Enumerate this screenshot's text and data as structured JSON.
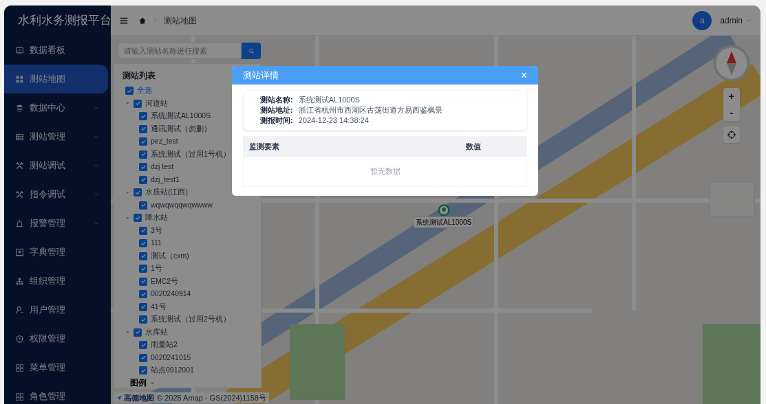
{
  "brand": {
    "title": "水利水务测报平台"
  },
  "sidebar": {
    "items": [
      {
        "label": "数据看板",
        "selected": false,
        "expandable": false
      },
      {
        "label": "测站地图",
        "selected": true,
        "expandable": false
      },
      {
        "label": "数据中心",
        "selected": false,
        "expandable": true
      },
      {
        "label": "测站管理",
        "selected": false,
        "expandable": true
      },
      {
        "label": "测站调试",
        "selected": false,
        "expandable": true
      },
      {
        "label": "指令调试",
        "selected": false,
        "expandable": true
      },
      {
        "label": "报警管理",
        "selected": false,
        "expandable": true
      },
      {
        "label": "字典管理",
        "selected": false,
        "expandable": false
      },
      {
        "label": "组织管理",
        "selected": false,
        "expandable": false
      },
      {
        "label": "用户管理",
        "selected": false,
        "expandable": false
      },
      {
        "label": "权限管理",
        "selected": false,
        "expandable": false
      },
      {
        "label": "菜单管理",
        "selected": false,
        "expandable": false
      },
      {
        "label": "角色管理",
        "selected": false,
        "expandable": false
      }
    ]
  },
  "header": {
    "breadcrumb": [
      "测站地图"
    ],
    "user": {
      "avatar": "a",
      "name": "admin"
    }
  },
  "search": {
    "placeholder": "请输入测站名称进行搜索"
  },
  "station_tree": {
    "title": "测站列表",
    "select_all": {
      "label": "全选",
      "checked": true
    },
    "groups": [
      {
        "label": "河道站",
        "checked": true,
        "expanded": true,
        "children": [
          {
            "label": "系统测试AL1000S",
            "checked": true
          },
          {
            "label": "通讯测试（勿删）",
            "checked": true
          },
          {
            "label": "pez_test",
            "checked": true
          },
          {
            "label": "系统测试（过用1号机）",
            "checked": true
          },
          {
            "label": "dzj test",
            "checked": true
          },
          {
            "label": "dzj_test1",
            "checked": true
          }
        ]
      },
      {
        "label": "水质站(江西)",
        "checked": true,
        "expanded": true,
        "children": [
          {
            "label": "wqwqwqqwqwwww",
            "checked": true
          }
        ]
      },
      {
        "label": "降水站",
        "checked": true,
        "expanded": true,
        "children": [
          {
            "label": "3号",
            "checked": true
          },
          {
            "label": "111",
            "checked": true
          },
          {
            "label": "测试（cxm)",
            "checked": true
          },
          {
            "label": "1号",
            "checked": true
          },
          {
            "label": "EMC2号",
            "checked": true
          },
          {
            "label": "0020240914",
            "checked": true
          },
          {
            "label": "41号",
            "checked": true
          },
          {
            "label": "系统测试（过用2号机）",
            "checked": true
          }
        ]
      },
      {
        "label": "水库站",
        "checked": true,
        "expanded": true,
        "children": [
          {
            "label": "雨量站2",
            "checked": true
          },
          {
            "label": "0020241015",
            "checked": true
          },
          {
            "label": "站点0912001",
            "checked": true
          }
        ]
      }
    ]
  },
  "legend": {
    "label": "图例"
  },
  "map": {
    "marker_label": "系统测试AL1000S",
    "attribution_logo": "高德地图",
    "attribution": "© 2025 Amap - GS(2024)1158号",
    "zoom_in": "+",
    "zoom_out": "-"
  },
  "dialog": {
    "title": "测站详情",
    "close": "×",
    "fields": [
      {
        "label": "测站名称:",
        "value": "系统测试AL1000S"
      },
      {
        "label": "测站地址:",
        "value": "浙江省杭州市西湖区古荡街道方易西鉴枫景"
      },
      {
        "label": "测报时间:",
        "value": "2024-12-23 14:38:24"
      }
    ],
    "table": {
      "columns": [
        "监测要素",
        "数值"
      ],
      "empty_text": "暂无数据"
    }
  }
}
